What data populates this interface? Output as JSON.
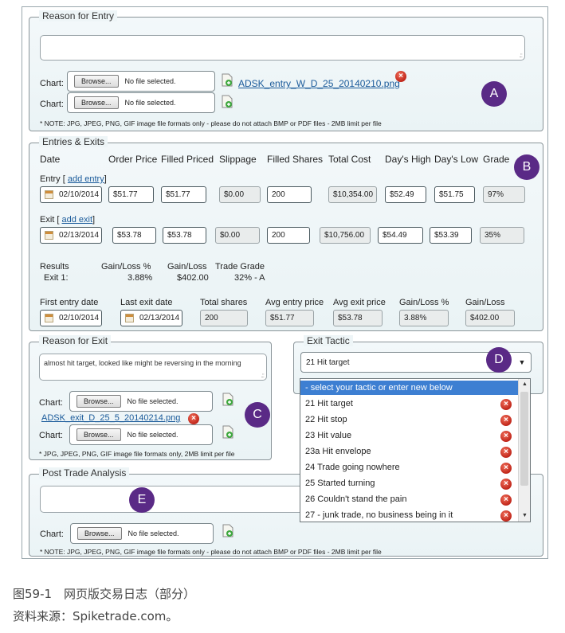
{
  "reason_entry": {
    "legend": "Reason for Entry",
    "chart_label": "Chart:",
    "browse": "Browse...",
    "no_file": "No file selected.",
    "attached_link": "ADSK_entry_W_D_25_20140210.png",
    "note": "* NOTE: JPG, JPEG, PNG, GIF image file formats only - please do not attach BMP or PDF files - 2MB limit per file"
  },
  "entries_exits": {
    "legend": "Entries & Exits",
    "headers": [
      "Date",
      "Order Price",
      "Filled Priced",
      "Slippage",
      "Filled Shares",
      "Total Cost",
      "Day's High",
      "Day's Low",
      "Grade"
    ],
    "entry_label": "Entry [",
    "add_entry": "add entry",
    "bracket_close": "]",
    "entry": {
      "date": "02/10/2014",
      "order": "$51.77",
      "filled": "$51.77",
      "slippage": "$0.00",
      "shares": "200",
      "total": "$10,354.00",
      "high": "$52.49",
      "low": "$51.75",
      "grade": "97%"
    },
    "exit_label": "Exit [",
    "add_exit": "add exit",
    "exit": {
      "date": "02/13/2014",
      "order": "$53.78",
      "filled": "$53.78",
      "slippage": "$0.00",
      "shares": "200",
      "total": "$10,756.00",
      "high": "$54.49",
      "low": "$53.39",
      "grade": "35%"
    },
    "results": {
      "label": "Results",
      "h1": "Gain/Loss %",
      "h2": "Gain/Loss",
      "h3": "Trade Grade",
      "row_label": "Exit 1:",
      "v1": "3.88%",
      "v2": "$402.00",
      "v3": "32% - A"
    },
    "summary": {
      "headers": [
        "First entry date",
        "Last exit date",
        "Total shares",
        "Avg entry price",
        "Avg exit price",
        "Gain/Loss %",
        "Gain/Loss"
      ],
      "first_entry": "02/10/2014",
      "last_exit": "02/13/2014",
      "total_shares": "200",
      "avg_entry": "$51.77",
      "avg_exit": "$53.78",
      "gain_pct": "3.88%",
      "gain": "$402.00"
    }
  },
  "reason_exit": {
    "legend": "Reason for Exit",
    "text": "almost hit target, looked like might be reversing in the morning",
    "chart_label": "Chart:",
    "browse": "Browse...",
    "no_file": "No file selected.",
    "attached_link": "ADSK_exit_D_25_5_20140214.png",
    "note": "* JPG, JPEG, PNG, GIF image file formats only, 2MB limit per file"
  },
  "exit_tactic": {
    "legend": "Exit Tactic",
    "selected": "21 Hit target",
    "options_header": "- select your tactic or enter new below",
    "options": [
      "21 Hit target",
      "22 Hit stop",
      "23 Hit value",
      "23a Hit envelope",
      "24 Trade going nowhere",
      "25 Started turning",
      "26 Couldn't stand the pain",
      "27 - junk trade, no business being in it"
    ]
  },
  "post_trade": {
    "legend": "Post Trade Analysis",
    "chart_label": "Chart:",
    "browse": "Browse...",
    "no_file": "No file selected.",
    "note": "* NOTE: JPG, JPEG, PNG, GIF image file formats only - please do not attach BMP or PDF files - 2MB limit per file"
  },
  "badges": {
    "a": "A",
    "b": "B",
    "c": "C",
    "d": "D",
    "e": "E"
  },
  "caption": {
    "line1": "图59-1　网页版交易日志（部分）",
    "line2": "资料来源：Spiketrade.com。"
  },
  "colors": {
    "badge": "#5a2a86",
    "highlight": "#3d7fd2",
    "link": "#1a5a9a",
    "delete": "#c0261a"
  },
  "icons": [
    "attach-doc-icon",
    "delete-icon",
    "calendar-icon",
    "chevron-down-icon",
    "scroll-up-icon",
    "scroll-down-icon",
    "resize-grip-icon"
  ]
}
